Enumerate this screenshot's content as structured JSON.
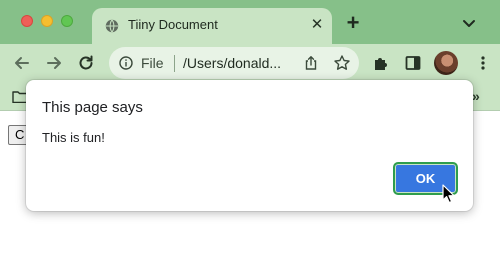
{
  "window": {
    "tab_title": "Tiiny Document",
    "new_tab_glyph": "+",
    "close_glyph": "✕"
  },
  "omnibox": {
    "scheme_label": "File",
    "url_text": "/Users/donald..."
  },
  "bookmarks": {
    "more_glyph": "»"
  },
  "page": {
    "button_label": "C"
  },
  "dialog": {
    "title": "This page says",
    "message": "This is fun!",
    "ok_label": "OK"
  },
  "colors": {
    "tabstrip": "#86c089",
    "toolbar": "#c9e4c4",
    "ok_button": "#3777e0",
    "focus_ring": "#2f9d4c"
  },
  "icons": [
    "globe-icon",
    "back-arrow-icon",
    "forward-arrow-icon",
    "reload-icon",
    "info-icon",
    "share-icon",
    "star-icon",
    "puzzle-icon",
    "sidebar-icon",
    "kebab-menu-icon",
    "folder-icon",
    "chevron-down-icon",
    "mouse-cursor-icon"
  ]
}
